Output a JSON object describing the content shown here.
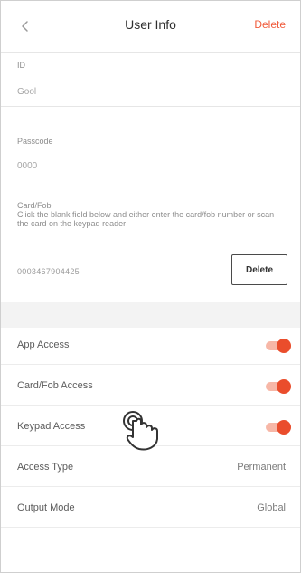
{
  "header": {
    "title": "User Info",
    "back_icon": "chevron-left-icon",
    "delete_label": "Delete"
  },
  "fields": {
    "id_label": "ID",
    "id_value": "Gool",
    "passcode_label": "Passcode",
    "passcode_value": "0000",
    "card_label": "Card/Fob",
    "card_help": "Click the blank field below and either enter the card/fob number or scan the card on the keypad reader",
    "card_value": "0003467904425",
    "delete_button": "Delete"
  },
  "settings": [
    {
      "label": "App Access",
      "type": "toggle",
      "enabled": true
    },
    {
      "label": "Card/Fob Access",
      "type": "toggle",
      "enabled": true
    },
    {
      "label": "Keypad Access",
      "type": "toggle",
      "enabled": true
    },
    {
      "label": "Access Type",
      "type": "value",
      "value": "Permanent"
    },
    {
      "label": "Output Mode",
      "type": "value",
      "value": "Global"
    }
  ],
  "colors": {
    "accent": "#ea4d2c",
    "accent_light": "#f7b7a7",
    "delete": "#f05a3a"
  }
}
